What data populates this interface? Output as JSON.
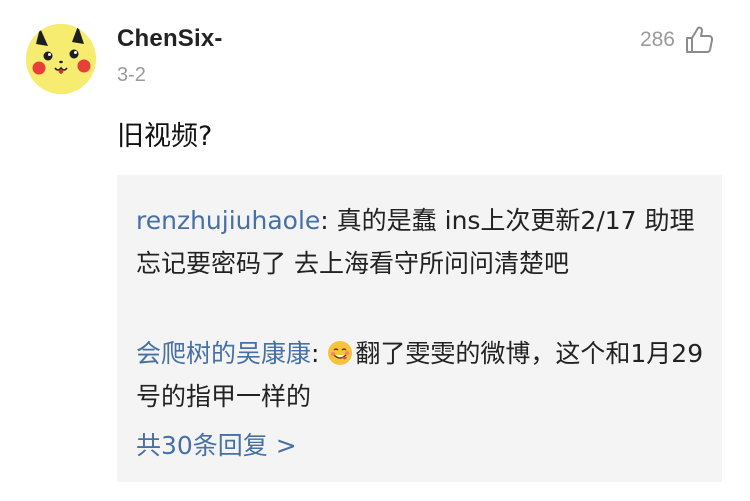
{
  "comment": {
    "username": "ChenSix-",
    "date": "3-2",
    "like_count": "286",
    "text": "旧视频?",
    "avatar_icon": "pikachu-avatar",
    "like_icon": "thumbs-up-icon"
  },
  "replies": [
    {
      "author": "renzhujiuhaole",
      "separator": ": ",
      "text": "真的是蠢 ins上次更新2/17 助理忘记要密码了 去上海看守所问问清楚吧"
    },
    {
      "author": "会爬树的吴康康",
      "separator": ": ",
      "emoji": "yummy-face-emoji",
      "text": "翻了雯雯的微博，这个和1月29号的指甲一样的"
    }
  ],
  "more_replies_label": "共30条回复 >",
  "colors": {
    "link": "#4670a6",
    "reply_background": "#f4f4f4",
    "muted": "#9a9a9a"
  }
}
